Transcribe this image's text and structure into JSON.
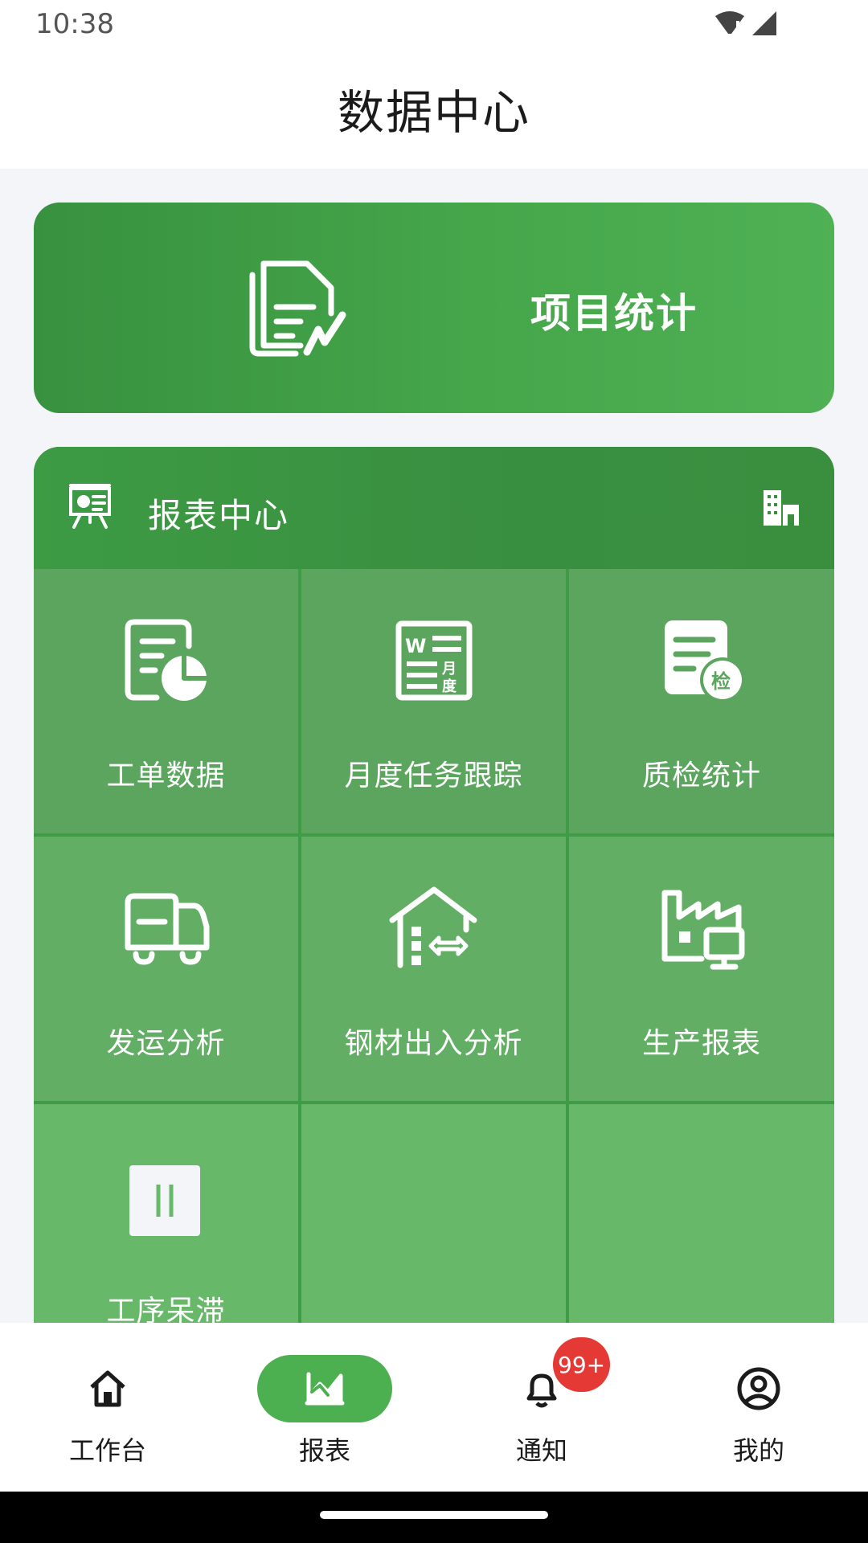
{
  "status_bar": {
    "time": "10:38"
  },
  "header": {
    "title": "数据中心"
  },
  "project_card": {
    "label": "项目统计",
    "icon": "document-chart-icon"
  },
  "report_center": {
    "title": "报表中心",
    "icon": "presentation-board-icon",
    "right_icon": "building-icon",
    "items": [
      {
        "label": "工单数据",
        "icon": "document-pie-chart-icon"
      },
      {
        "label": "月度任务跟踪",
        "icon": "monthly-word-doc-icon"
      },
      {
        "label": "质检统计",
        "icon": "inspection-doc-icon"
      },
      {
        "label": "发运分析",
        "icon": "delivery-truck-icon"
      },
      {
        "label": "钢材出入分析",
        "icon": "warehouse-transfer-icon"
      },
      {
        "label": "生产报表",
        "icon": "factory-monitor-icon"
      },
      {
        "label": "工序呆滞",
        "icon": "pause-icon"
      },
      {
        "label": "",
        "icon": ""
      },
      {
        "label": "",
        "icon": ""
      }
    ]
  },
  "bottom_nav": {
    "items": [
      {
        "label": "工作台",
        "icon": "home-icon",
        "active": false
      },
      {
        "label": "报表",
        "icon": "chart-icon",
        "active": true
      },
      {
        "label": "通知",
        "icon": "bell-icon",
        "badge": "99+",
        "active": false
      },
      {
        "label": "我的",
        "icon": "user-circle-icon",
        "active": false
      }
    ]
  },
  "colors": {
    "accent": "#4caf50",
    "badge": "#e53935"
  }
}
